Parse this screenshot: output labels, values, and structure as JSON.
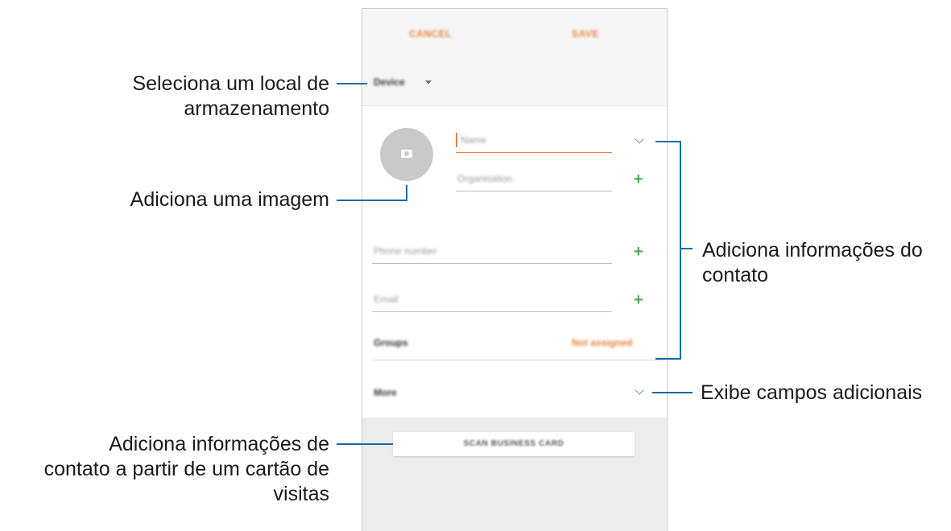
{
  "screen": {
    "topbar": {
      "cancel_label": "CANCEL",
      "save_label": "SAVE"
    },
    "storage": {
      "label": "Device"
    },
    "fields": {
      "name_placeholder": "Name",
      "organisation_placeholder": "Organisation",
      "phone_placeholder": "Phone number",
      "email_placeholder": "Email"
    },
    "groups": {
      "label": "Groups",
      "value": "Not assigned"
    },
    "more": {
      "label": "More"
    },
    "scan_button_label": "SCAN BUSINESS CARD",
    "plus_glyph": "+"
  },
  "annotations": {
    "storage": [
      "Seleciona um local de",
      "armazenamento"
    ],
    "image": "Adiciona uma imagem",
    "contact_info": [
      "Adiciona informações do",
      "contato"
    ],
    "more_fields": "Exibe campos adicionais",
    "business_card": [
      "Adiciona informações de",
      "contato a partir de um cartão de",
      "visitas"
    ]
  },
  "colors": {
    "accent": "#e8823a",
    "plus": "#4caf50",
    "callout_line": "#1a6aa3"
  }
}
